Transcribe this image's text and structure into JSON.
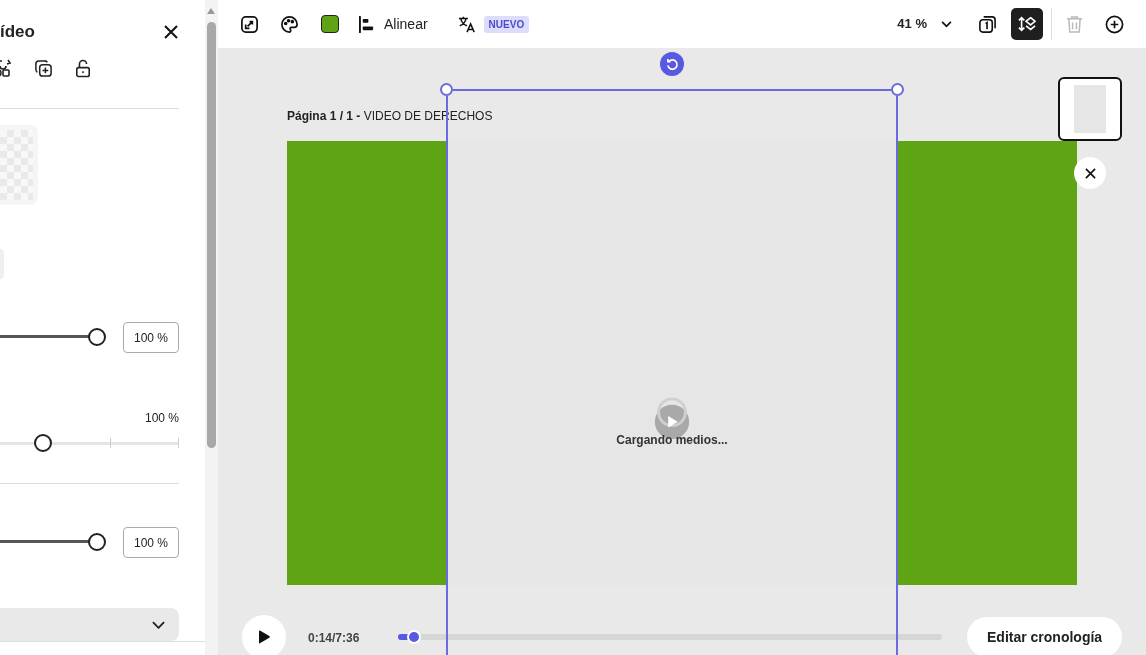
{
  "panel": {
    "title": "ídeo",
    "sliders": [
      {
        "kind": "boxed",
        "level": 1,
        "reading": "100 %"
      },
      {
        "kind": "ticked",
        "level": 0.24,
        "reading": "100 %"
      },
      {
        "kind": "boxed",
        "level": 1,
        "reading": "100 %"
      }
    ]
  },
  "toolbar": {
    "align_label": "Alinear",
    "badge": "NUEVO",
    "zoom": "41 %",
    "layers_selected": true,
    "delete_disabled": true
  },
  "canvas": {
    "page_label": "**Página 1 / 1 -** VIDEO DE DERECHOS",
    "loading": "Cargando medios..."
  },
  "player": {
    "time": "0:14/7:36",
    "level": 0.03,
    "timeline_button": "Editar cronología"
  }
}
